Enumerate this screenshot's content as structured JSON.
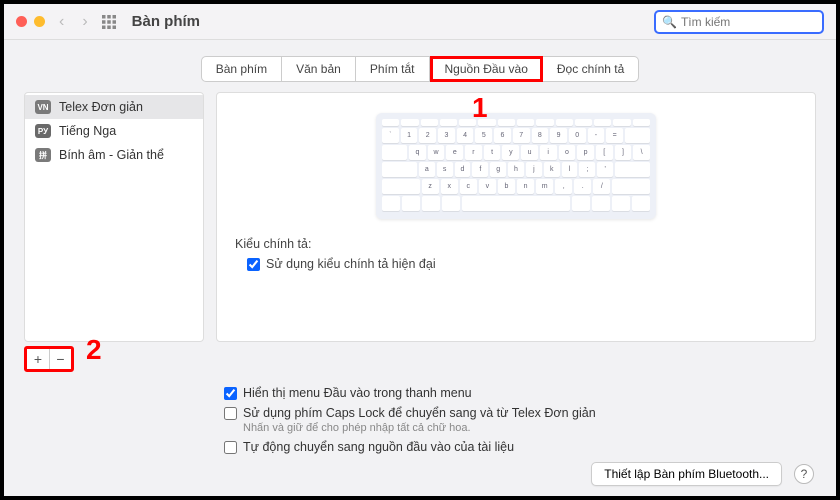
{
  "window": {
    "title": "Bàn phím"
  },
  "search": {
    "placeholder": "Tìm kiếm"
  },
  "tabs": [
    {
      "label": "Bàn phím"
    },
    {
      "label": "Văn bản"
    },
    {
      "label": "Phím tắt"
    },
    {
      "label": "Nguồn Đầu vào",
      "active": true
    },
    {
      "label": "Đọc chính tả"
    }
  ],
  "sources": [
    {
      "icon": "VN",
      "label": "Telex Đơn giản",
      "selected": true
    },
    {
      "icon": "РУ",
      "label": "Tiếng Nga"
    },
    {
      "icon": "拼",
      "label": "Bính âm - Giản thể"
    }
  ],
  "keyboard_rows": [
    [
      "`",
      "1",
      "2",
      "3",
      "4",
      "5",
      "6",
      "7",
      "8",
      "9",
      "0",
      "-",
      "="
    ],
    [
      "q",
      "w",
      "e",
      "r",
      "t",
      "y",
      "u",
      "i",
      "o",
      "p",
      "[",
      "]",
      "\\"
    ],
    [
      "a",
      "s",
      "d",
      "f",
      "g",
      "h",
      "j",
      "k",
      "l",
      ";",
      "'"
    ],
    [
      "z",
      "x",
      "c",
      "v",
      "b",
      "n",
      "m",
      ",",
      ".",
      "/"
    ]
  ],
  "spelling": {
    "heading": "Kiểu chính tả:",
    "option": "Sử dụng kiểu chính tả hiện đại",
    "checked": true
  },
  "options": [
    {
      "label": "Hiển thị menu Đầu vào trong thanh menu",
      "checked": true
    },
    {
      "label": "Sử dụng phím Caps Lock để chuyển sang và từ Telex Đơn giản",
      "sub": "Nhấn và giữ để cho phép nhập tất cả chữ hoa.",
      "checked": false
    },
    {
      "label": "Tự động chuyển sang nguồn đầu vào của tài liệu",
      "checked": false
    }
  ],
  "footer": {
    "bluetooth": "Thiết lập Bàn phím Bluetooth..."
  },
  "annotations": {
    "one": "1",
    "two": "2"
  }
}
